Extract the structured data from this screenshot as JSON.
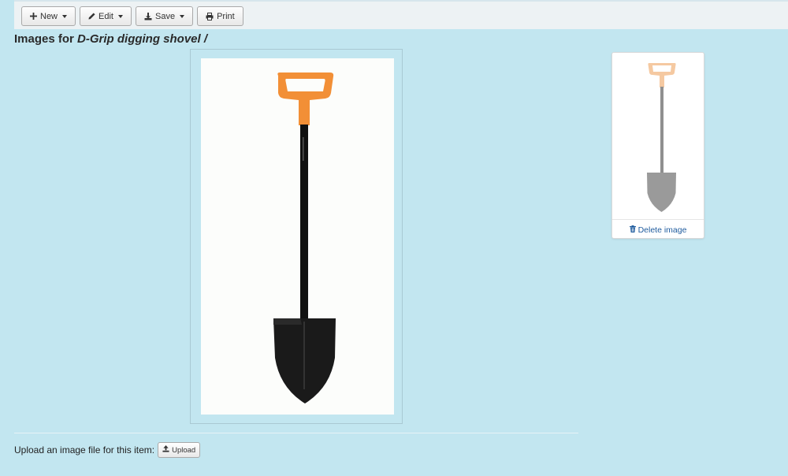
{
  "toolbar": {
    "buttons": [
      {
        "label": "New",
        "icon": "plus-icon",
        "dropdown": true
      },
      {
        "label": "Edit",
        "icon": "pencil-icon",
        "dropdown": true
      },
      {
        "label": "Save",
        "icon": "download-icon",
        "dropdown": true
      },
      {
        "label": "Print",
        "icon": "print-icon",
        "dropdown": false
      }
    ]
  },
  "page": {
    "title_prefix": "Images for",
    "title_item": "D-Grip digging shovel /"
  },
  "main_image": {
    "subject": "shovel-image",
    "handle_color": "#f28f36",
    "shaft_color": "#111111"
  },
  "thumbnail": {
    "subject": "shovel-thumbnail",
    "delete_label": "Delete image",
    "delete_icon": "trash-icon",
    "link_color": "#205c9e"
  },
  "upload": {
    "label": "Upload an image file for this item:",
    "button_label": "Upload",
    "button_icon": "upload-icon"
  },
  "colors": {
    "background": "#c2e6f0",
    "toolbar": "#edf2f4"
  }
}
